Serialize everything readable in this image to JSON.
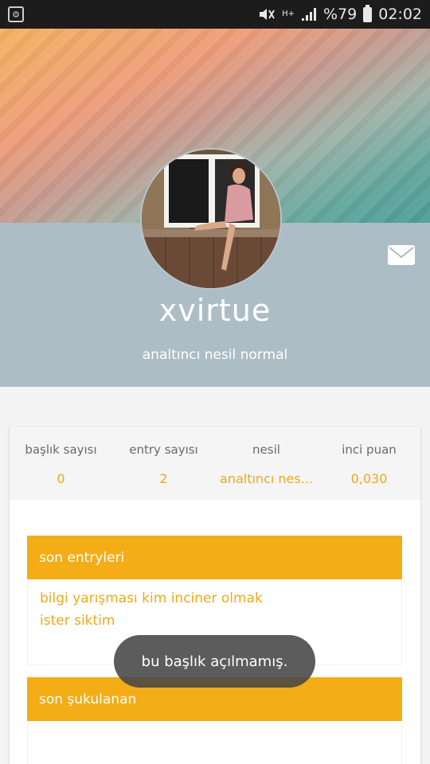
{
  "status_bar": {
    "battery": "%79",
    "time": "02:02",
    "network": "H+"
  },
  "profile": {
    "username": "xvirtue",
    "subtitle": "analtıncı nesil normal"
  },
  "stats": [
    {
      "label": "başlık sayısı",
      "value": "0"
    },
    {
      "label": "entry sayısı",
      "value": "2"
    },
    {
      "label": "nesil",
      "value": "analtıncı nes..."
    },
    {
      "label": "inci puan",
      "value": "0,030"
    }
  ],
  "sections": {
    "recent_entries": {
      "title": "son entryleri",
      "items": [
        "bilgi yarışması kim inciner olmak ister siktim"
      ]
    },
    "recent_likes": {
      "title": "son şukulanan"
    }
  },
  "toast": "bu başlık açılmamış.",
  "colors": {
    "accent": "#f4ad16",
    "profile_band": "#adbdc6"
  }
}
